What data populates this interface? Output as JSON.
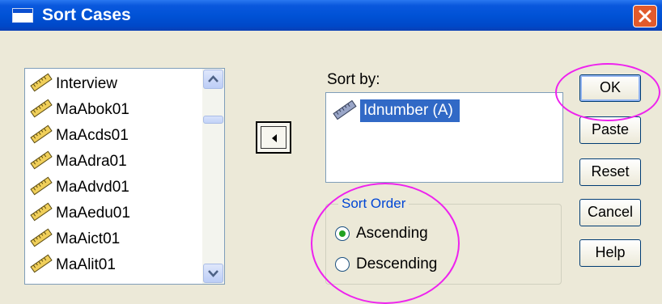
{
  "window": {
    "title": "Sort Cases"
  },
  "variables": [
    "Interview",
    "MaAbok01",
    "MaAcds01",
    "MaAdra01",
    "MaAdvd01",
    "MaAedu01",
    "MaAict01",
    "MaAlit01"
  ],
  "sort_by": {
    "label": "Sort by:",
    "items": [
      "Idnumber (A)"
    ]
  },
  "sort_order": {
    "legend": "Sort Order",
    "options": [
      "Ascending",
      "Descending"
    ],
    "selected": "Ascending"
  },
  "buttons": {
    "ok": "OK",
    "paste": "Paste",
    "reset": "Reset",
    "cancel": "Cancel",
    "help": "Help"
  },
  "colors": {
    "title_bar": "#0052d6",
    "selection": "#3169c6",
    "annotation": "#ee22ee",
    "group_legend": "#0046d5"
  }
}
